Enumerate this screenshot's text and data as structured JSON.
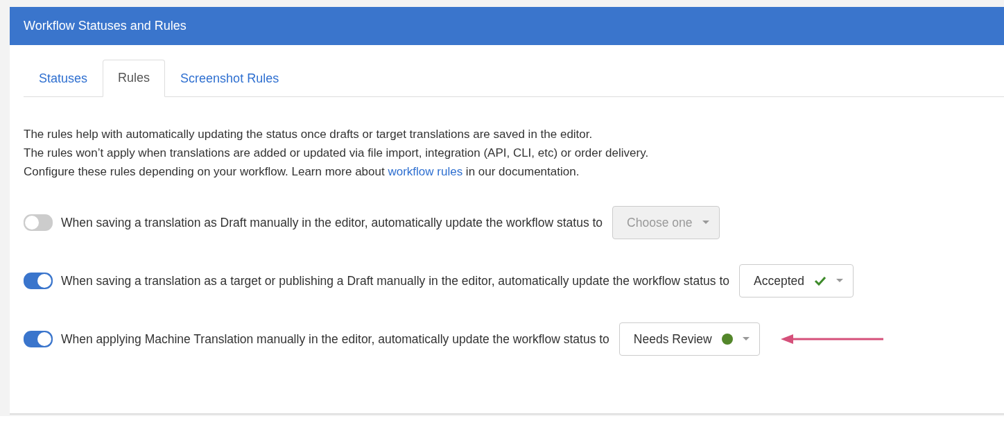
{
  "panel": {
    "title": "Workflow Statuses and Rules"
  },
  "tabs": [
    {
      "label": "Statuses",
      "selected": false
    },
    {
      "label": "Rules",
      "selected": true
    },
    {
      "label": "Screenshot Rules",
      "selected": false
    }
  ],
  "intro": [
    "The rules help with automatically updating the status once drafts or target translations are saved in the editor.",
    "The rules won’t apply when translations are added or updated via file import, integration (API, CLI, etc) or order delivery."
  ],
  "intro_link_line": {
    "before": "Configure these rules depending on your workflow. Learn more about ",
    "link": "workflow rules",
    "after": " in our documentation."
  },
  "rules": [
    {
      "on": false,
      "text": "When saving a translation as Draft manually in the editor, automatically update the workflow status to",
      "select": {
        "disabled": true,
        "placeholder": "Choose one"
      },
      "highlighted": false
    },
    {
      "on": true,
      "text": "When saving a translation as a target or publishing a Draft manually in the editor, automatically update the workflow status to",
      "select": {
        "disabled": false,
        "value": "Accepted",
        "kind": "check",
        "color": "#3d8a2a"
      },
      "highlighted": false
    },
    {
      "on": true,
      "text": "When applying Machine Translation manually in the editor, automatically update the workflow status to",
      "select": {
        "disabled": false,
        "value": "Needs Review",
        "kind": "dot",
        "color": "#53862a"
      },
      "highlighted": true
    }
  ]
}
